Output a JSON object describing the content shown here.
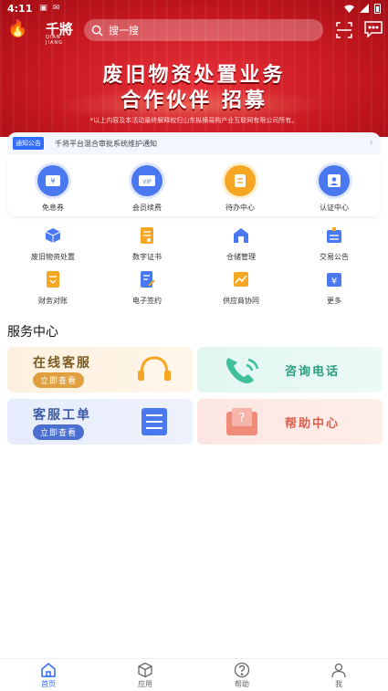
{
  "status_bar": {
    "time": "4:11"
  },
  "header": {
    "brand": "千將",
    "brand_en": "QIAN JIANG",
    "search_placeholder": "搜一搜"
  },
  "banner": {
    "line1": "废旧物资处置业务",
    "line2": "合作伙伴 招募",
    "note": "*以上内容及本活动最终解释权归山东枞横易购产业互联网有限公司所有。"
  },
  "notice": {
    "tag": "通知公告",
    "text": "千将平台混合审批系统维护通知"
  },
  "quick_actions": [
    {
      "label": "免息券",
      "icon": "coupon-icon"
    },
    {
      "label": "会员续费",
      "icon": "vip-card-icon"
    },
    {
      "label": "待办中心",
      "icon": "todo-icon"
    },
    {
      "label": "认证中心",
      "icon": "id-card-icon"
    }
  ],
  "grid_row1": [
    {
      "label": "废旧物资处置",
      "icon": "box-icon"
    },
    {
      "label": "数字证书",
      "icon": "certificate-icon"
    },
    {
      "label": "仓储管理",
      "icon": "warehouse-icon"
    },
    {
      "label": "交易公告",
      "icon": "announcement-icon"
    }
  ],
  "grid_row2": [
    {
      "label": "财务对账",
      "icon": "finance-icon"
    },
    {
      "label": "电子签约",
      "icon": "e-sign-icon"
    },
    {
      "label": "供应商协同",
      "icon": "chart-icon"
    },
    {
      "label": "更多",
      "icon": "more-icon"
    }
  ],
  "service_center": {
    "title": "服务中心",
    "items": [
      {
        "name": "在线客服",
        "button": "立即查看"
      },
      {
        "name": "咨询电话"
      },
      {
        "name": "客服工单",
        "button": "立即查看"
      },
      {
        "name": "帮助中心"
      }
    ]
  },
  "tabbar": [
    {
      "label": "首页"
    },
    {
      "label": "应用"
    },
    {
      "label": "帮助"
    },
    {
      "label": "我"
    }
  ],
  "colors": {
    "brand_red": "#c81820",
    "accent_blue": "#2f6bff",
    "orange": "#f5a623"
  }
}
